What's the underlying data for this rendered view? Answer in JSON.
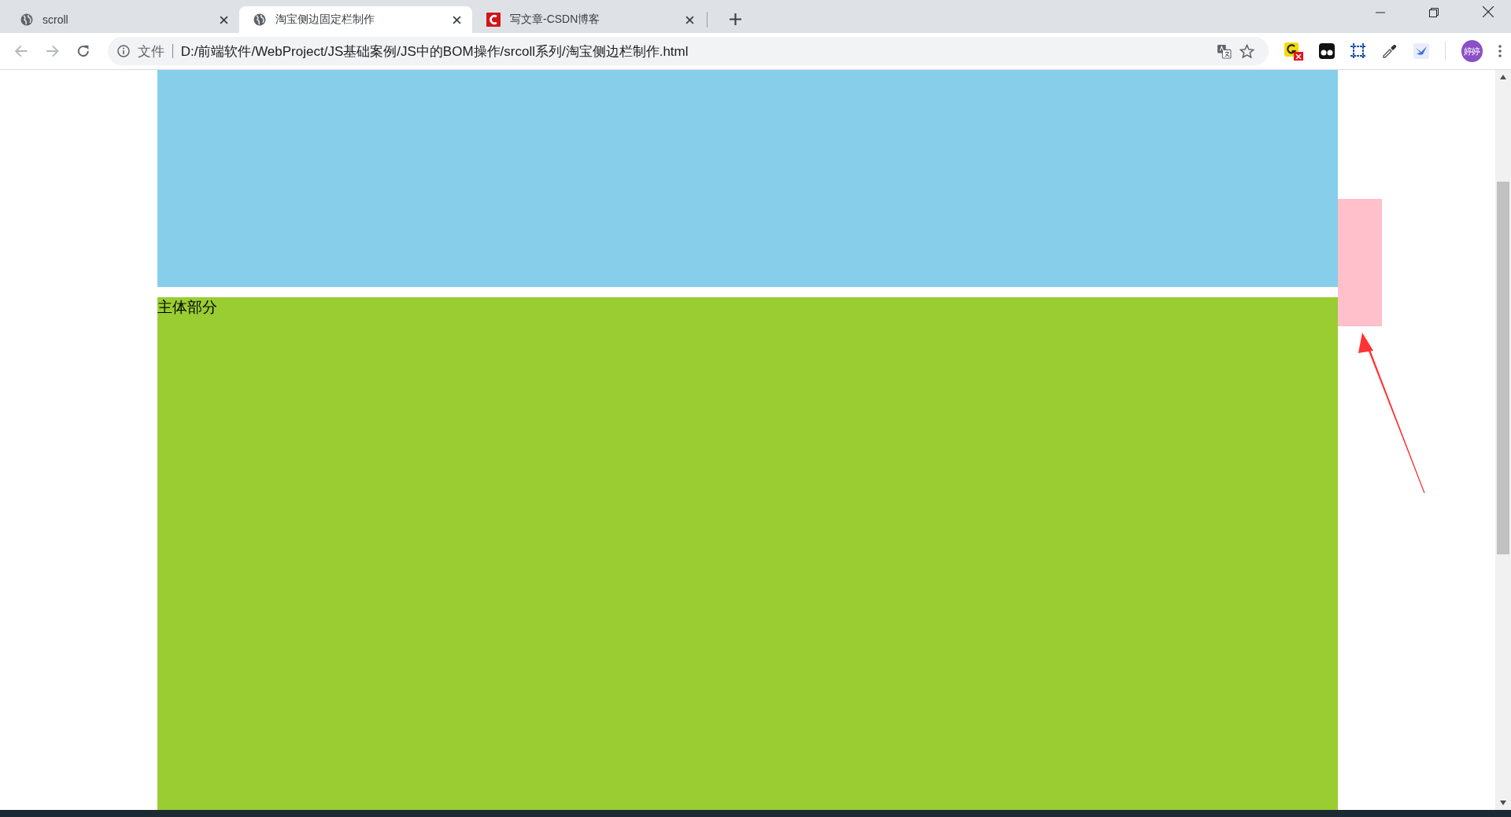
{
  "tabs": [
    {
      "title": "scroll",
      "kind": "page",
      "selected": false
    },
    {
      "title": "淘宝侧边固定栏制作",
      "kind": "page",
      "selected": true
    },
    {
      "title": "写文章-CSDN博客",
      "kind": "site",
      "selected": false
    }
  ],
  "address_bar": {
    "scheme_label": "文件",
    "url": "D:/前端软件/WebProject/JS基础案例/JS中的BOM操作/srcoll系列/淘宝侧边栏制作.html"
  },
  "profile": {
    "label": "婷婷"
  },
  "page": {
    "main_label": "主体部分"
  }
}
